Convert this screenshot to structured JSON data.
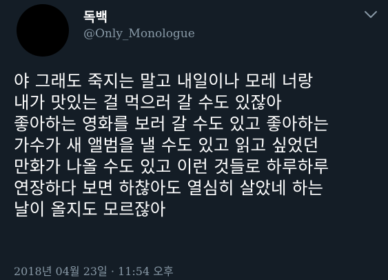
{
  "author": {
    "display_name": "독백",
    "handle": "@Only_Monologue"
  },
  "tweet": {
    "lines": [
      "야 그래도 죽지는 말고 내일이나 모레 너랑",
      "내가 맛있는 걸 먹으러 갈 수도 있잖아",
      "좋아하는 영화를 보러 갈 수도 있고 좋아하는",
      "가수가 새 앨범을 낼 수도 있고 읽고 싶었던",
      "만화가 나올 수도 있고 이런 것들로 하루하루",
      "연장하다 보면 하찮아도 열심히 살았네 하는",
      "날이 올지도 모르잖아"
    ],
    "timestamp": "2018년 04월 23일 · 11:54 오후"
  },
  "icons": {
    "menu": "chevron-down-icon"
  },
  "colors": {
    "background": "#141d26",
    "text_primary": "#ffffff",
    "text_secondary": "#8899a6"
  }
}
